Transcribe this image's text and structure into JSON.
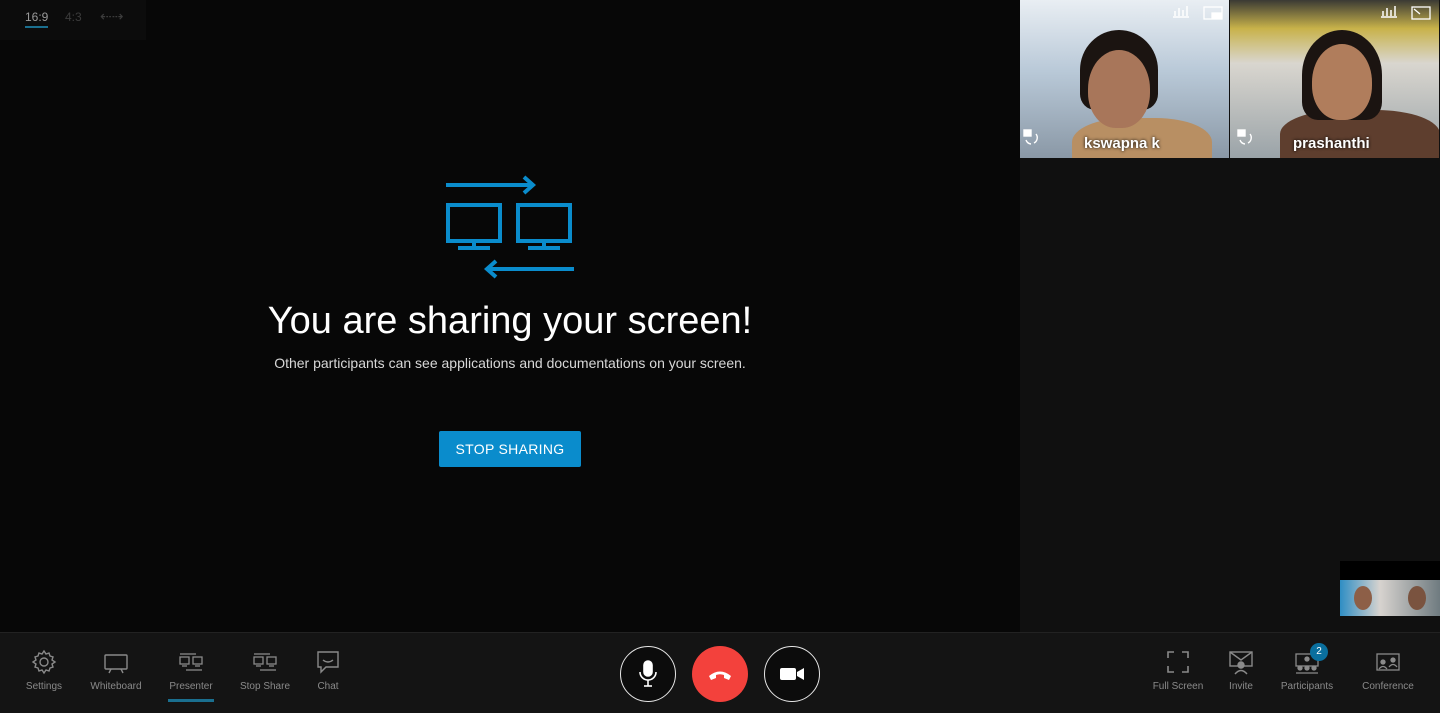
{
  "aspect": {
    "ratio_169": "16:9",
    "ratio_43": "4:3",
    "swap_glyph": "⇠⇢"
  },
  "share": {
    "headline": "You are sharing your screen!",
    "subline": "Other participants can see applications and documentations on your screen.",
    "stop_button": "STOP SHARING",
    "accent_color": "#0a8ccc"
  },
  "participants": [
    {
      "name": "kswapna k"
    },
    {
      "name": "prashanthi"
    }
  ],
  "toolbar": {
    "left": [
      {
        "label": "Settings",
        "icon": "gear-icon"
      },
      {
        "label": "Whiteboard",
        "icon": "whiteboard-icon"
      },
      {
        "label": "Presenter",
        "icon": "presenter-icon",
        "active": true
      },
      {
        "label": "Stop Share",
        "icon": "stop-share-icon"
      },
      {
        "label": "Chat",
        "icon": "chat-icon"
      }
    ],
    "center": [
      {
        "name": "mic",
        "icon": "microphone-icon"
      },
      {
        "name": "hangup",
        "icon": "hang-up-icon",
        "color": "#f3413c"
      },
      {
        "name": "camera",
        "icon": "video-camera-icon"
      }
    ],
    "right": [
      {
        "label": "Full Screen",
        "icon": "fullscreen-icon"
      },
      {
        "label": "Invite",
        "icon": "invite-icon"
      },
      {
        "label": "Participants",
        "icon": "participants-icon",
        "badge": "2"
      },
      {
        "label": "Conference",
        "icon": "conference-icon"
      }
    ]
  }
}
